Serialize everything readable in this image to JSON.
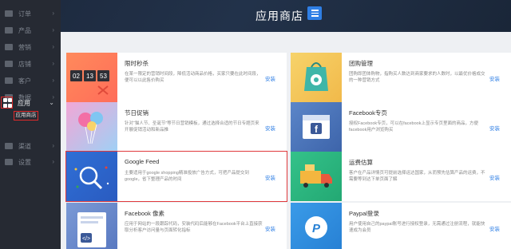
{
  "header": {
    "title": "应用商店"
  },
  "sidebar": {
    "items": [
      {
        "label": "订单"
      },
      {
        "label": "产品"
      },
      {
        "label": "营销"
      },
      {
        "label": "店铺"
      },
      {
        "label": "客户"
      },
      {
        "label": "数据"
      },
      {
        "label": "应用"
      },
      {
        "label": "渠道"
      },
      {
        "label": "设置"
      }
    ],
    "sub_item": "应用商店"
  },
  "apps": [
    {
      "name": "限时秒杀",
      "desc": "在某一限定的营销时间段，降低活动商品价格，买家只要在此时间段，便可以以此售价购买",
      "install": "安装",
      "countdown": [
        "02",
        "13",
        "53"
      ]
    },
    {
      "name": "团购管理",
      "desc": "团购即团体购物，指购买人数达到商家要求的人数时，以最优价格成交的一种营销方式",
      "install": "安装"
    },
    {
      "name": "节日促销",
      "desc": "针对“猫人节、圣诞节”等节日营销模板，通过选择合适的节日专题页来开展促销活动和新品推",
      "install": "安装"
    },
    {
      "name": "Facebook专页",
      "desc": "授权Facebook专页，可以在facebook上显示专页里面的商品，方便facebook用户浏览购买",
      "install": "安装"
    },
    {
      "name": "Google Feed",
      "desc": "主要适用于google shopping精准投放广告方式，可把产品提交到google，省下整理产品的时间",
      "install": "安装"
    },
    {
      "name": "运费估算",
      "desc": "客户在产品详情页可提前选择运达国家，从而预先估算产品的运费，不需要等到达下单页面了解",
      "install": "安装"
    },
    {
      "name": "Facebook 像素",
      "desc": "应用于网站的一段跟踪代码，安装代码后能够在Facebook平台上直接获取分析客户访问量与页面转化指标",
      "install": "安装"
    },
    {
      "name": "Paypal登录",
      "desc": "用户使用自己的paypal账号进行授权登录，无需通过注册流程，就能快速成为会员",
      "install": "安装"
    }
  ],
  "colors": {
    "sidebar_bg": "#262a33",
    "header_bg": "#1d2a3e",
    "accent": "#2f7fe5",
    "highlight": "#e0393c"
  }
}
